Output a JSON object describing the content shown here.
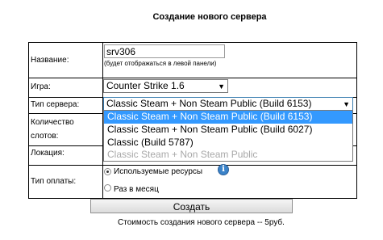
{
  "page": {
    "title": "Создание нового сервера"
  },
  "form": {
    "name_label": "Название:",
    "name_value": "srv306",
    "name_hint": "(будет отображаться в левой панели)",
    "game_label": "Игра:",
    "game_value": "Counter Strike 1.6",
    "server_type_label": "Тип сервера:",
    "server_type_value": "Classic Steam + Non Steam Public (Build 6153)",
    "server_type_options": [
      {
        "label": "Classic Steam + Non Steam Public (Build 6153)",
        "state": "selected"
      },
      {
        "label": "Classic Steam + Non Steam Public (Build 6027)",
        "state": "normal"
      },
      {
        "label": "Classic (Build 5787)",
        "state": "normal"
      },
      {
        "label": "Classic Steam + Non Steam Public",
        "state": "disabled"
      }
    ],
    "slots_label_line1": "Количество",
    "slots_label_line2": "слотов:",
    "location_label": "Локация:",
    "payment_label": "Тип оплаты:",
    "payment_options": [
      {
        "label": "Используемые ресурсы",
        "checked": true
      },
      {
        "label": "Раз в месяц",
        "checked": false
      }
    ],
    "info_icon": "info-icon",
    "submit_label": "Создать",
    "cost_text": "Стоимость создания нового сервера -- 5руб."
  },
  "colors": {
    "highlight": "#3399ff",
    "info": "#3b83c9"
  }
}
